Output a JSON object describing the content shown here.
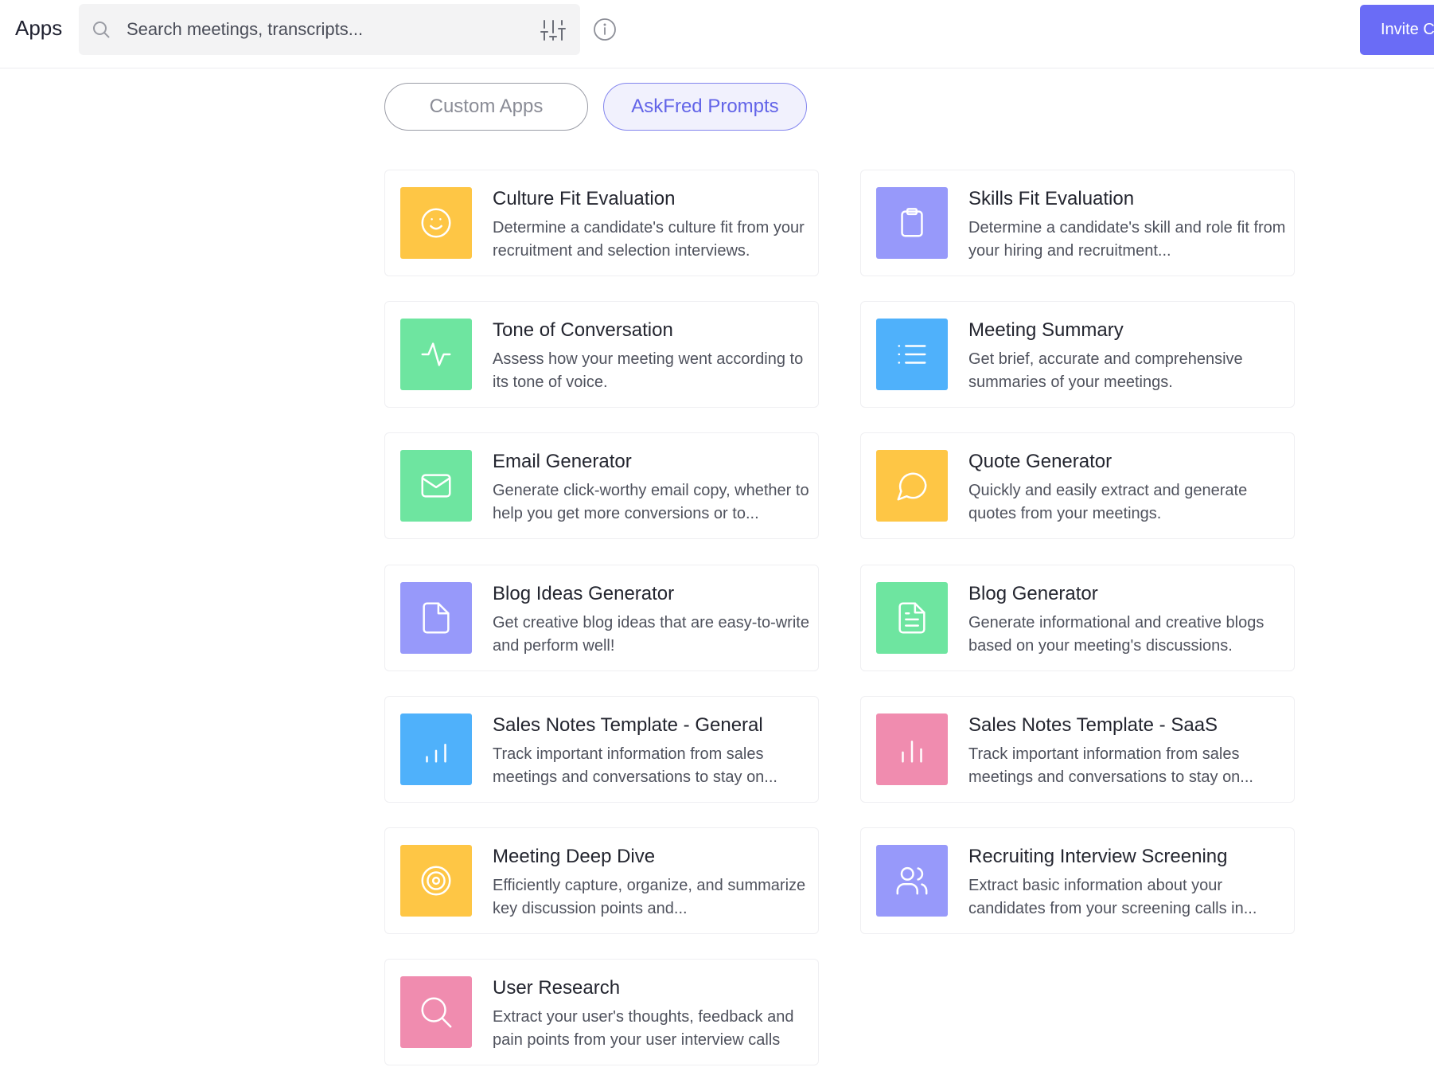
{
  "header": {
    "title": "Apps",
    "search_placeholder": "Search meetings, transcripts...",
    "invite_label": "Invite C"
  },
  "tabs": [
    {
      "label": "Custom Apps",
      "active": false
    },
    {
      "label": "AskFred Prompts",
      "active": true
    }
  ],
  "colors": {
    "accent": "#6a6cf6",
    "yellow": "#fec645",
    "purple": "#9799fa",
    "green": "#6ee5a0",
    "blue": "#4fb1fb",
    "pink": "#f08caf"
  },
  "apps": [
    {
      "title": "Culture Fit Evaluation",
      "desc": "Determine a candidate's culture fit from your recruitment and selection interviews.",
      "icon": "smile-icon",
      "color": "yellow"
    },
    {
      "title": "Skills Fit Evaluation",
      "desc": "Determine a candidate's skill and role fit from your hiring and recruitment...",
      "icon": "clipboard-icon",
      "color": "purple"
    },
    {
      "title": "Tone of Conversation",
      "desc": "Assess how your meeting went according to its tone of voice.",
      "icon": "activity-icon",
      "color": "green"
    },
    {
      "title": "Meeting Summary",
      "desc": "Get brief, accurate and comprehensive summaries of your meetings.",
      "icon": "list-icon",
      "color": "blue"
    },
    {
      "title": "Email Generator",
      "desc": "Generate click-worthy email copy, whether to help you get more conversions or to...",
      "icon": "mail-icon",
      "color": "green"
    },
    {
      "title": "Quote Generator",
      "desc": "Quickly and easily extract and generate quotes from your meetings.",
      "icon": "message-circle-icon",
      "color": "yellow"
    },
    {
      "title": "Blog Ideas Generator",
      "desc": "Get creative blog ideas that are easy-to-write and perform well!",
      "icon": "file-icon",
      "color": "purple"
    },
    {
      "title": "Blog Generator",
      "desc": "Generate informational and creative blogs based on your meeting's discussions.",
      "icon": "file-text-icon",
      "color": "green"
    },
    {
      "title": "Sales Notes Template - General",
      "desc": "Track important information from sales meetings and conversations to stay on...",
      "icon": "bar-chart-icon",
      "color": "blue"
    },
    {
      "title": "Sales Notes Template - SaaS",
      "desc": "Track important information from sales meetings and conversations to stay on...",
      "icon": "bar-chart-2-icon",
      "color": "pink"
    },
    {
      "title": "Meeting Deep Dive",
      "desc": "Efficiently capture, organize, and summarize key discussion points and...",
      "icon": "target-icon",
      "color": "yellow"
    },
    {
      "title": "Recruiting Interview Screening",
      "desc": "Extract basic information about your candidates from your screening calls in...",
      "icon": "users-icon",
      "color": "purple"
    },
    {
      "title": "User Research",
      "desc": "Extract your user's thoughts, feedback and pain points from your user interview calls",
      "icon": "search-icon",
      "color": "pink"
    }
  ]
}
